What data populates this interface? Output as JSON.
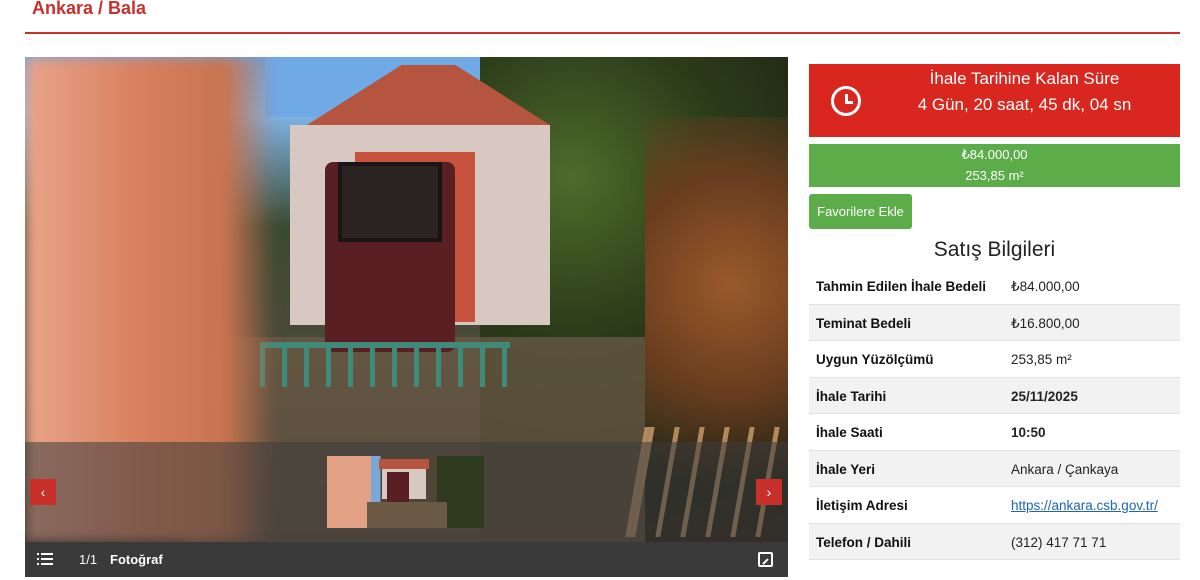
{
  "header": {
    "location": "Ankara / Bala"
  },
  "gallery": {
    "counter": "1/1",
    "label": "Fotoğraf",
    "icons": [
      "list-icon",
      "expand-icon",
      "chevron-left-icon",
      "chevron-right-icon"
    ]
  },
  "countdown": {
    "title": "İhale Tarihine Kalan Süre",
    "time": "4 Gün, 20 saat, 45 dk, 04 sn",
    "icon": "clock-icon"
  },
  "price_box": {
    "price": "₺84.000,00",
    "area": "253,85 m²"
  },
  "favorites_button": "Favorilere Ekle",
  "sales_info": {
    "title": "Satış Bilgileri",
    "rows": [
      {
        "key": "Tahmin Edilen İhale Bedeli",
        "value": "₺84.000,00"
      },
      {
        "key": "Teminat Bedeli",
        "value": "₺16.800,00"
      },
      {
        "key": "Uygun Yüzölçümü",
        "value": "253,85 m²"
      },
      {
        "key": "İhale Tarihi",
        "value": "25/11/2025"
      },
      {
        "key": "İhale Saati",
        "value": "10:50"
      },
      {
        "key": "İhale Yeri",
        "value": "Ankara / Çankaya"
      },
      {
        "key": "İletişim Adresi",
        "value": "https://ankara.csb.gov.tr/"
      },
      {
        "key": "Telefon / Dahili",
        "value": "(312) 417 71 71"
      }
    ]
  },
  "colors": {
    "accent_red": "#d9271f",
    "accent_green": "#5cad4a",
    "link_blue": "#1a66b5"
  }
}
